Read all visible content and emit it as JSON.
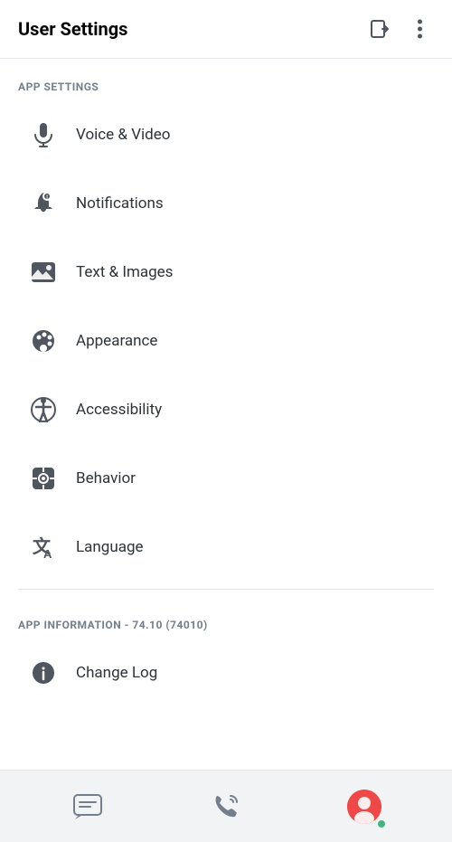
{
  "header": {
    "title": "User Settings",
    "login_icon": "login-icon",
    "more_icon": "more-icon"
  },
  "app_settings_section": {
    "label": "APP SETTINGS",
    "items": [
      {
        "id": "voice-video",
        "label": "Voice & Video",
        "icon": "microphone-icon"
      },
      {
        "id": "notifications",
        "label": "Notifications",
        "icon": "bell-icon"
      },
      {
        "id": "text-images",
        "label": "Text & Images",
        "icon": "image-icon"
      },
      {
        "id": "appearance",
        "label": "Appearance",
        "icon": "palette-icon"
      },
      {
        "id": "accessibility",
        "label": "Accessibility",
        "icon": "accessibility-icon"
      },
      {
        "id": "behavior",
        "label": "Behavior",
        "icon": "behavior-icon"
      },
      {
        "id": "language",
        "label": "Language",
        "icon": "language-icon"
      }
    ]
  },
  "app_info_section": {
    "label": "APP INFORMATION - 74.10 (74010)",
    "items": [
      {
        "id": "change-log",
        "label": "Change Log",
        "icon": "info-icon"
      }
    ]
  },
  "bottom_nav": {
    "items": [
      {
        "id": "chat",
        "icon": "chat-icon"
      },
      {
        "id": "calls",
        "icon": "calls-icon"
      },
      {
        "id": "profile",
        "icon": "profile-icon"
      }
    ]
  }
}
